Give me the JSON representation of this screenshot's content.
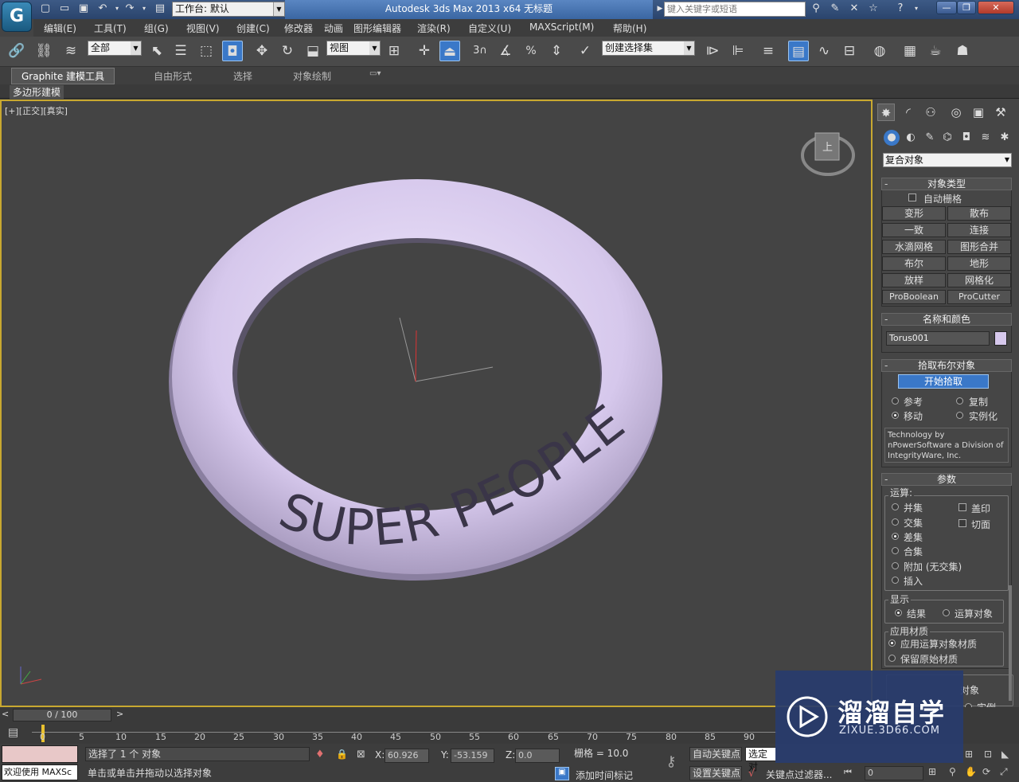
{
  "titlebar": {
    "workspace_label": "工作台: 默认",
    "app_title": "Autodesk 3ds Max  2013 x64      无标题",
    "search_placeholder": "键入关键字或短语"
  },
  "menubar": {
    "items": [
      "编辑(E)",
      "工具(T)",
      "组(G)",
      "视图(V)",
      "创建(C)",
      "修改器",
      "动画",
      "图形编辑器",
      "渲染(R)",
      "自定义(U)",
      "MAXScript(M)",
      "帮助(H)"
    ]
  },
  "toolbar": {
    "selection_filter": "全部",
    "ref_coord": "视图",
    "named_selection": "创建选择集",
    "snap_num": "3"
  },
  "ribbon": {
    "tabs": [
      "Graphite 建模工具",
      "自由形式",
      "选择",
      "对象绘制"
    ],
    "sub_label": "多边形建模"
  },
  "viewport": {
    "label": "[+][正交][真实]",
    "text_on_torus": "SUPER PEOPLE",
    "torus_color": "#d6c8ec",
    "cube_label": "上"
  },
  "command_panel": {
    "category": "复合对象",
    "object_type": {
      "title": "对象类型",
      "autogrid": "自动栅格",
      "buttons": [
        "变形",
        "散布",
        "一致",
        "连接",
        "水滴网格",
        "图形合并",
        "布尔",
        "地形",
        "放样",
        "网格化",
        "ProBoolean",
        "ProCutter"
      ]
    },
    "name_color": {
      "title": "名称和颜色",
      "name": "Torus001",
      "swatch": "#d6c8ec"
    },
    "pick_boolean": {
      "title": "拾取布尔对象",
      "start_pick": "开始拾取",
      "options": [
        "参考",
        "复制",
        "移动",
        "实例化"
      ],
      "credit": "Technology by nPowerSoftware a Division of IntegrityWare, Inc."
    },
    "params": {
      "title": "参数",
      "op_label": "运算:",
      "operations": [
        "并集",
        "交集",
        "差集",
        "合集",
        "附加 (无交集)",
        "插入"
      ],
      "checks": [
        "盖印",
        "切面"
      ],
      "display_label": "显示",
      "display_options": [
        "结果",
        "运算对象"
      ],
      "material_label": "应用材质",
      "material_options": [
        "应用运算对象材质",
        "保留原始材质"
      ],
      "partial_right_text": "对象",
      "partial_right_radio": "实例",
      "partial_spinner": "0"
    }
  },
  "timeline": {
    "frame": "0 / 100",
    "ticks": [
      "0",
      "5",
      "10",
      "15",
      "20",
      "25",
      "30",
      "35",
      "40",
      "45",
      "50",
      "55",
      "60",
      "65",
      "70",
      "75",
      "80",
      "85",
      "90"
    ]
  },
  "status": {
    "maxscript": "欢迎使用 MAXSc",
    "selected": "选择了 1 个 对象",
    "prompt": "单击或单击并拖动以选择对象",
    "x_value": "60.926",
    "y_value": "-53.159",
    "z_value": "0.0",
    "x_label": "X:",
    "y_label": "Y:",
    "z_label": "Z:",
    "grid": "栅格 = 10.0",
    "add_time_tag": "添加时间标记",
    "auto_key": "自动关键点",
    "set_key": "设置关键点",
    "selected_obj": "选定对",
    "key_filters": "关键点过滤器...",
    "frame_field": "0"
  },
  "watermark": {
    "brand": "溜溜自学",
    "url": "ZIXUE.3D66.COM"
  }
}
